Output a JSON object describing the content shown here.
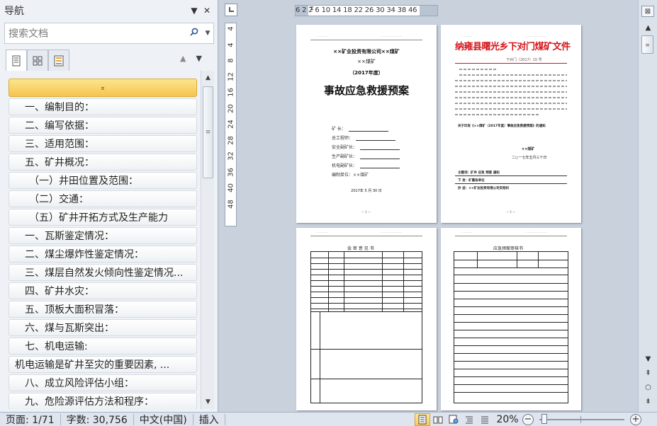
{
  "nav": {
    "title": "导航",
    "dropdown_glyph": "▼",
    "close_glyph": "✕",
    "search_placeholder": "搜索文档",
    "tab_arrows": {
      "up": "▲",
      "down": "▼"
    },
    "collapse_glyph": "⌅",
    "headings": [
      {
        "level": 1,
        "text": "一、编制目的："
      },
      {
        "level": 1,
        "text": "二、编写依据："
      },
      {
        "level": 1,
        "text": "三、适用范围："
      },
      {
        "level": 1,
        "text": "五、矿井概况："
      },
      {
        "level": 2,
        "text": "（一）井田位置及范围："
      },
      {
        "level": 2,
        "text": "（二）交通："
      },
      {
        "level": 2,
        "text": "（五）矿井开拓方式及生产能力"
      },
      {
        "level": 1,
        "text": "一、瓦斯鉴定情况："
      },
      {
        "level": 1,
        "text": "二、煤尘爆炸性鉴定情况："
      },
      {
        "level": 1,
        "text": "三、煤层自然发火倾向性鉴定情况..."
      },
      {
        "level": 1,
        "text": "四、矿井水灾："
      },
      {
        "level": 1,
        "text": "五、顶板大面积冒落："
      },
      {
        "level": 1,
        "text": "六、煤与瓦斯突出："
      },
      {
        "level": 1,
        "text": "七、机电运输:"
      },
      {
        "level": 0,
        "text": "机电运输是矿井至灾的重要因素, ..."
      },
      {
        "level": 1,
        "text": "八、成立风险评估小组："
      },
      {
        "level": 1,
        "text": "九、危险源评估方法和程序："
      }
    ]
  },
  "ruler": {
    "horizontal_ticks": "6 2 2 6 10 14 18 22 26 30 34 38 46",
    "vertical_ticks": [
      "4",
      "4",
      "8",
      "12",
      "16",
      "20",
      "24",
      "28",
      "32",
      "36",
      "40",
      "48"
    ]
  },
  "pages": {
    "p1": {
      "line1": "××矿业投资有限公司××煤矿",
      "line2": "××煤矿",
      "line3": "（2017年度）",
      "title": "事故应急救援预案",
      "signatures": [
        "矿 长：",
        "总工程师：",
        "安全副矿长：",
        "生产副矿长：",
        "机电副矿长：",
        "编制单位：××煤矿"
      ],
      "date": "2017年 5 月 30 日"
    },
    "p2": {
      "red_title": "纳雍县曙光乡下对门煤矿文件",
      "doc_no": "下对门〔2017〕15 号",
      "subject": "关于印发《××煤矿（2017年度）事故应急救援预案》的通知",
      "org": "××煤矿",
      "date": "二○一七年五月三十日",
      "cc_line": "主题词：矿井 应急 预案 通知",
      "cc_line2": "下 发：矿属各单位",
      "cc_line3": "抄 送：××矿业投资有限公司安检科"
    },
    "p3": {
      "title": "会 审 意 见 书"
    },
    "p4": {
      "title": "应急预案审核书"
    }
  },
  "status": {
    "page": "页面: 1/71",
    "words": "字数: 30,756",
    "language": "中文(中国)",
    "mode": "插入",
    "zoom": "20%",
    "zoom_level_percent": 20
  }
}
